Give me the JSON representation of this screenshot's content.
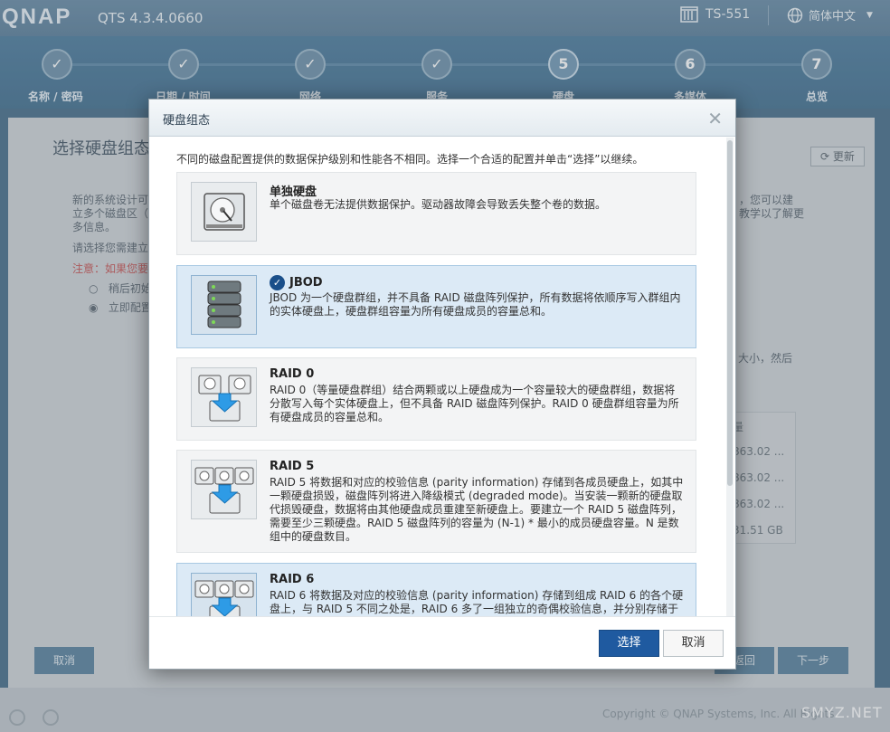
{
  "app": {
    "logo": "QNAP",
    "version": "QTS 4.3.4.0660",
    "model": "TS-551",
    "language": "简体中文"
  },
  "steps": [
    {
      "label": "名称 / 密码",
      "status": "done",
      "mark": "✓"
    },
    {
      "label": "日期 / 时间",
      "status": "done",
      "mark": "✓"
    },
    {
      "label": "网络",
      "status": "done",
      "mark": "✓"
    },
    {
      "label": "服务",
      "status": "done",
      "mark": "✓"
    },
    {
      "label": "硬盘",
      "status": "active",
      "mark": "5"
    },
    {
      "label": "多媒体",
      "status": "pending",
      "mark": "6"
    },
    {
      "label": "总览",
      "status": "pending",
      "mark": "7"
    }
  ],
  "background": {
    "heading": "选择硬盘组态",
    "refresh": "更新",
    "text1": "新的系统设计可",
    "text1b": "立多个磁盘区（",
    "text1c": "多信息。",
    "text1r": "，您可以建",
    "text1r2": "教学以了解更",
    "text2": "请选择您需建立",
    "warning": "注意：如果您要",
    "radio1": "稍后初始",
    "radio2": "立即配置",
    "side_text": "大小，然后",
    "table_header": "量",
    "table_rows": [
      "863.02 ...",
      "863.02 ...",
      "863.02 ...",
      "31.51 GB"
    ],
    "cancel": "取消",
    "back": "返回",
    "next": "下一步",
    "copyright": "Copyright © QNAP Systems, Inc. All Rights",
    "watermark": "SMYZ.NET"
  },
  "dialog": {
    "title": "硬盘组态",
    "intro": "不同的磁盘配置提供的数据保护级别和性能各不相同。选择一个合适的配置并单击“选择”以继续。",
    "options": [
      {
        "title": "单独硬盘",
        "selected": false,
        "icon": "single-disk-icon",
        "desc": "单个磁盘卷无法提供数据保护。驱动器故障会导致丢失整个卷的数据。"
      },
      {
        "title": "JBOD",
        "selected": true,
        "icon": "jbod-stack-icon",
        "desc": "JBOD 为一个硬盘群组，并不具备 RAID 磁盘阵列保护，所有数据将依顺序写入群组内的实体硬盘上，硬盘群组容量为所有硬盘成员的容量总和。"
      },
      {
        "title": "RAID 0",
        "selected": false,
        "icon": "raid0-icon",
        "desc": "RAID 0（等量硬盘群组）结合两颗或以上硬盘成为一个容量较大的硬盘群组，数据将分散写入每个实体硬盘上，但不具备 RAID 磁盘阵列保护。RAID 0 硬盘群组容量为所有硬盘成员的容量总和。"
      },
      {
        "title": "RAID 5",
        "selected": false,
        "icon": "raid5-icon",
        "desc": "RAID 5 将数据和对应的校验信息 (parity information) 存储到各成员硬盘上，如其中一颗硬盘损毁，磁盘阵列将进入降级模式 (degraded mode)。当安装一颗新的硬盘取代损毁硬盘，数据将由其他硬盘成员重建至新硬盘上。要建立一个 RAID 5 磁盘阵列，需要至少三颗硬盘。RAID 5 磁盘阵列的容量为 (N-1) * 最小的成员硬盘容量。N 是数组中的硬盘数目。"
      },
      {
        "title": "RAID 6",
        "selected": true,
        "icon": "raid6-icon",
        "desc": "RAID 6 将数据及对应的校验信息 (parity information) 存储到组成 RAID 6 的各个硬盘上，与 RAID 5 不同之处是，RAID 6 多了一组独立的奇偶校验信息，并分别存储于"
      }
    ],
    "select_label": "选择",
    "cancel_label": "取消",
    "close_glyph": "✕"
  }
}
